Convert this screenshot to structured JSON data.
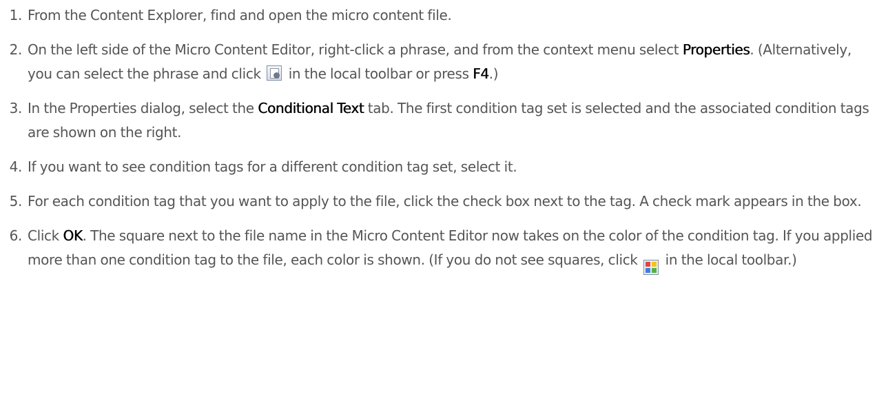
{
  "steps": [
    {
      "number": "1.",
      "t1": "From the Content Explorer, find and open the micro content file."
    },
    {
      "number": "2.",
      "t1": "On the left side of the Micro Content Editor, right-click a phrase, and from the context menu select ",
      "b1": "Properties",
      "t2": ". (Alternatively, you can select the phrase and click ",
      "icon": "properties-icon",
      "t3": " in the local toolbar or press ",
      "b2": "F4",
      "t4": ".)"
    },
    {
      "number": "3.",
      "t1": "In the Properties dialog, select the ",
      "b1": "Conditional Text",
      "t2": " tab. The first condition tag set is selected and the associated condition tags are shown on the right."
    },
    {
      "number": "4.",
      "t1": "If you want to see condition tags for a different condition tag set, select it."
    },
    {
      "number": "5.",
      "t1": "For each condition tag that you want to apply to the file, click the check box next to the tag. A check mark appears in the box."
    },
    {
      "number": "6.",
      "t1": "Click ",
      "b1": "OK",
      "t2": ". The square next to the file name in the Micro Content Editor now takes on the color of the condition tag. If you applied more than one condition tag to the file, each color is shown. (If you do not see squares, click ",
      "icon": "show-condition-squares-icon",
      "t3": " in the local toolbar.)"
    }
  ],
  "icon_colors": {
    "squares": [
      "#e2463a",
      "#f5c21a",
      "#3f7fd9",
      "#4fb34a"
    ]
  }
}
